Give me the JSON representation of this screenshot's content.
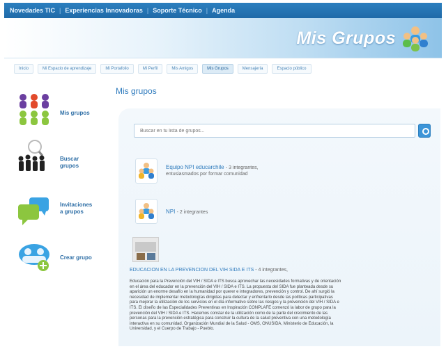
{
  "topnav": {
    "items": [
      {
        "label": "Novedades TIC"
      },
      {
        "label": "Experiencias Innovadoras"
      },
      {
        "label": "Soporte Técnico"
      },
      {
        "label": "Agenda"
      }
    ]
  },
  "banner": {
    "title": "Mis Grupos",
    "icon": "group-people-icon"
  },
  "tabs": [
    {
      "label": "Inicio"
    },
    {
      "label": "Mi Espacio de aprendizaje"
    },
    {
      "label": "Mi Portafolio"
    },
    {
      "label": "Mi Perfil"
    },
    {
      "label": "Mis Amigos"
    },
    {
      "label": "Mis Grupos"
    },
    {
      "label": "Mensajería"
    },
    {
      "label": "Espacio público"
    }
  ],
  "sidebar": {
    "items": [
      {
        "label_1": "Mis grupos",
        "label_2": "",
        "icon": "group-people-icon"
      },
      {
        "label_1": "Buscar",
        "label_2": "grupos",
        "icon": "search-people-icon"
      },
      {
        "label_1": "Invitaciones",
        "label_2": "a grupos",
        "icon": "chat-bubbles-icon"
      },
      {
        "label_1": "Crear grupo",
        "label_2": "",
        "icon": "create-group-icon"
      }
    ]
  },
  "main": {
    "title": "Mis grupos",
    "search_placeholder": "Buscar en tu lista de grupos...",
    "groups": [
      {
        "name": "Equipo NPI educarchile",
        "meta": "- 3 integrantes,",
        "desc": "entusiasmados por formar comunidad"
      },
      {
        "name": "NPI",
        "meta": "- 2 integrantes",
        "desc": ""
      },
      {
        "name": "EDUCACION EN LA PREVENCION DEL VIH SIDA E ITS",
        "meta": "- 4 integrantes,",
        "desc": "Educación para la Prevención del VIH / SIDA e ITS busca aprovechar las necesidades formativas y de orientación en el área del educador en la prevención del VIH / SIDA e ITS. La propuesta del SIDA fue planteada desde su aparición un enorme desafío en la humanidad por querer e integradores, prevención y control. De ahí surgió la necesidad de implementar metodologías dirigidas para detectar y enfrentarlo desde las políticas participativas para mejorar la utilización de los servicios en el día informativo sobre las riesgos y la prevención del VIH / SIDA e ITS. El diseño de las Especialidades Preventivas en Inspiración CONPLAFE comenzó la labor de grupo para la prevención del VIH / SIDA e ITS. Hacemos constar de la utilización como de la parte del crecimiento de las personas para la prevención estratégica para construir la cultura de la salud preventiva con una metodología interactiva en su comunidad. Organización Mundial de la Salud - OMS, ONUSIDA, Ministerio de Educación, la Universidad, y el Cuerpo de Trabajo - Pueblo."
      }
    ]
  }
}
